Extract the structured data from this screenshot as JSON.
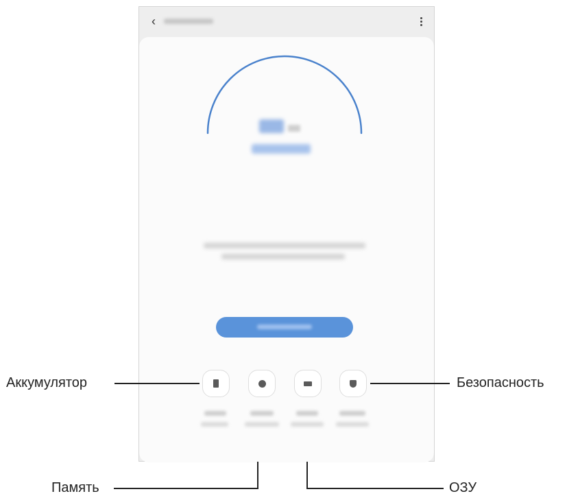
{
  "device": {
    "back_glyph": "‹",
    "back_icon": "chevron-left-icon",
    "more_icon": "more-vertical-icon",
    "arc_color": "#4a82cc",
    "button_color": "#5a93da"
  },
  "categories": [
    {
      "key": "battery",
      "icon": "battery-icon"
    },
    {
      "key": "storage",
      "icon": "storage-pie-icon"
    },
    {
      "key": "memory",
      "icon": "memory-chip-icon"
    },
    {
      "key": "security",
      "icon": "shield-icon"
    }
  ],
  "callouts": {
    "battery": "Аккумулятор",
    "security": "Безопасность",
    "storage": "Память",
    "memory": "ОЗУ"
  }
}
